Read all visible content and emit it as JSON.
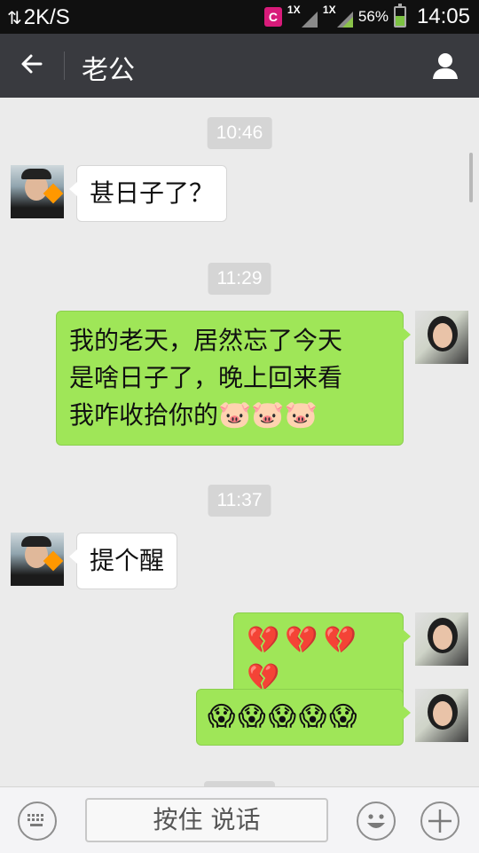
{
  "status_bar": {
    "net_speed": "2K/S",
    "net_arrows": "⇅",
    "app_icon_letter": "C",
    "sim1": "1X",
    "sim2": "1X",
    "battery": "56%",
    "battery_level": 0.56,
    "time": "14:05"
  },
  "header": {
    "back_icon": "back-arrow-icon",
    "title": "老公",
    "profile_icon": "person-icon"
  },
  "messages": [
    {
      "type": "timestamp",
      "text": "10:46"
    },
    {
      "type": "incoming",
      "text": "甚日子了？"
    },
    {
      "type": "timestamp",
      "text": "11:29"
    },
    {
      "type": "outgoing",
      "text_line1": "我的老天，居然忘了今天",
      "text_line2": "是啥日子了，晚上回来看",
      "text_line3": "我咋收拾你的",
      "emoji": "🐷🐷🐷"
    },
    {
      "type": "timestamp",
      "text": "11:37"
    },
    {
      "type": "incoming",
      "text": "提个醒"
    },
    {
      "type": "outgoing",
      "emoji": [
        "💔",
        "💔",
        "💔",
        "💔"
      ]
    },
    {
      "type": "outgoing",
      "emoji": [
        "😱",
        "😱",
        "😱",
        "😱",
        "😱"
      ]
    }
  ],
  "input_bar": {
    "keyboard_icon": "keyboard-icon",
    "hold_to_talk": "按住 说话",
    "emoji_icon": "smiley-icon",
    "plus_icon": "plus-icon"
  },
  "colors": {
    "title_bar": "#393a3f",
    "outgoing_bubble": "#9fe658",
    "incoming_bubble": "#ffffff",
    "chat_bg": "#ebebeb"
  }
}
